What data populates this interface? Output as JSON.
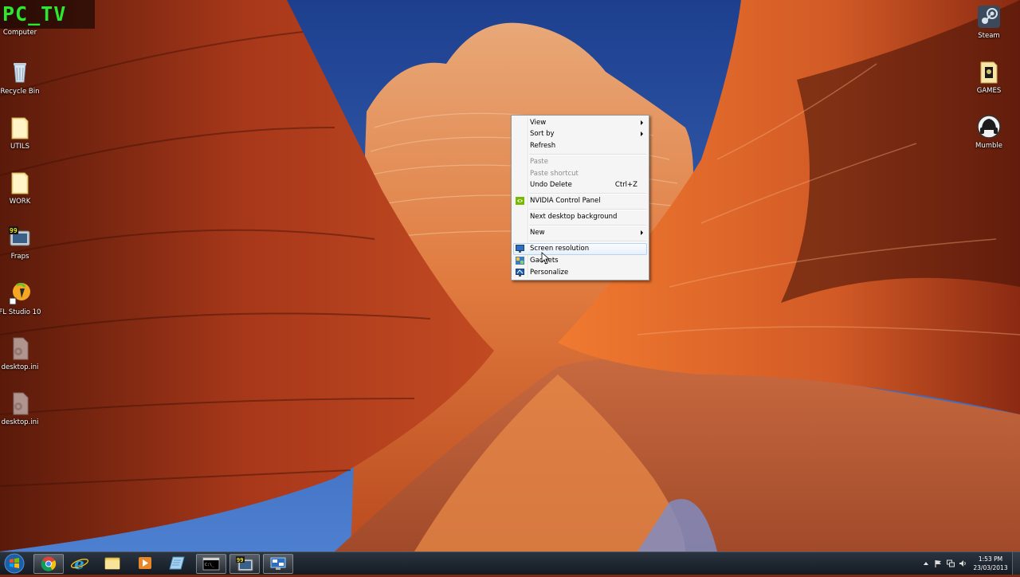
{
  "watermark": "PC_TV",
  "desktop_icons_left": [
    {
      "label": "Computer",
      "icon": "computer-icon"
    },
    {
      "label": "Recycle Bin",
      "icon": "recycle-bin-icon"
    },
    {
      "label": "UTILS",
      "icon": "folder-icon"
    },
    {
      "label": "WORK",
      "icon": "folder-icon"
    },
    {
      "label": "Fraps",
      "icon": "fraps-icon"
    },
    {
      "label": "FL Studio 10",
      "icon": "fl-studio-icon"
    },
    {
      "label": "desktop.ini",
      "icon": "settings-file-icon"
    },
    {
      "label": "desktop.ini",
      "icon": "settings-file-icon"
    }
  ],
  "desktop_icons_right": [
    {
      "label": "Steam",
      "icon": "steam-icon"
    },
    {
      "label": "GAMES",
      "icon": "games-folder-icon"
    },
    {
      "label": "Mumble",
      "icon": "mumble-icon"
    }
  ],
  "context_menu": {
    "items": {
      "view": {
        "label": "View"
      },
      "sort_by": {
        "label": "Sort by"
      },
      "refresh": {
        "label": "Refresh"
      },
      "paste": {
        "label": "Paste"
      },
      "paste_shortcut": {
        "label": "Paste shortcut"
      },
      "undo_delete": {
        "label": "Undo Delete",
        "shortcut": "Ctrl+Z"
      },
      "nvidia": {
        "label": "NVIDIA Control Panel",
        "icon": "nvidia-icon"
      },
      "next_bg": {
        "label": "Next desktop background"
      },
      "new": {
        "label": "New"
      },
      "screen_resolution": {
        "label": "Screen resolution",
        "icon": "monitor-icon"
      },
      "gadgets": {
        "label": "Gadgets",
        "icon": "gadgets-icon"
      },
      "personalize": {
        "label": "Personalize",
        "icon": "personalize-icon"
      }
    }
  },
  "taskbar": {
    "pinned": [
      "chrome-icon",
      "internet-explorer-icon",
      "file-explorer-icon",
      "media-player-icon",
      "notepad-icon",
      "command-prompt-icon",
      "fraps-icon",
      "remote-desktop-icon"
    ],
    "clock": {
      "time": "1:53 PM",
      "date": "23/03/2013"
    }
  },
  "colors": {
    "watermark_green": "#2ee82e",
    "menu_background": "#f5f5f5",
    "menu_hover_border": "#b8d2f0",
    "taskbar_top": "#2a3440",
    "taskbar_bottom": "#141a22"
  }
}
